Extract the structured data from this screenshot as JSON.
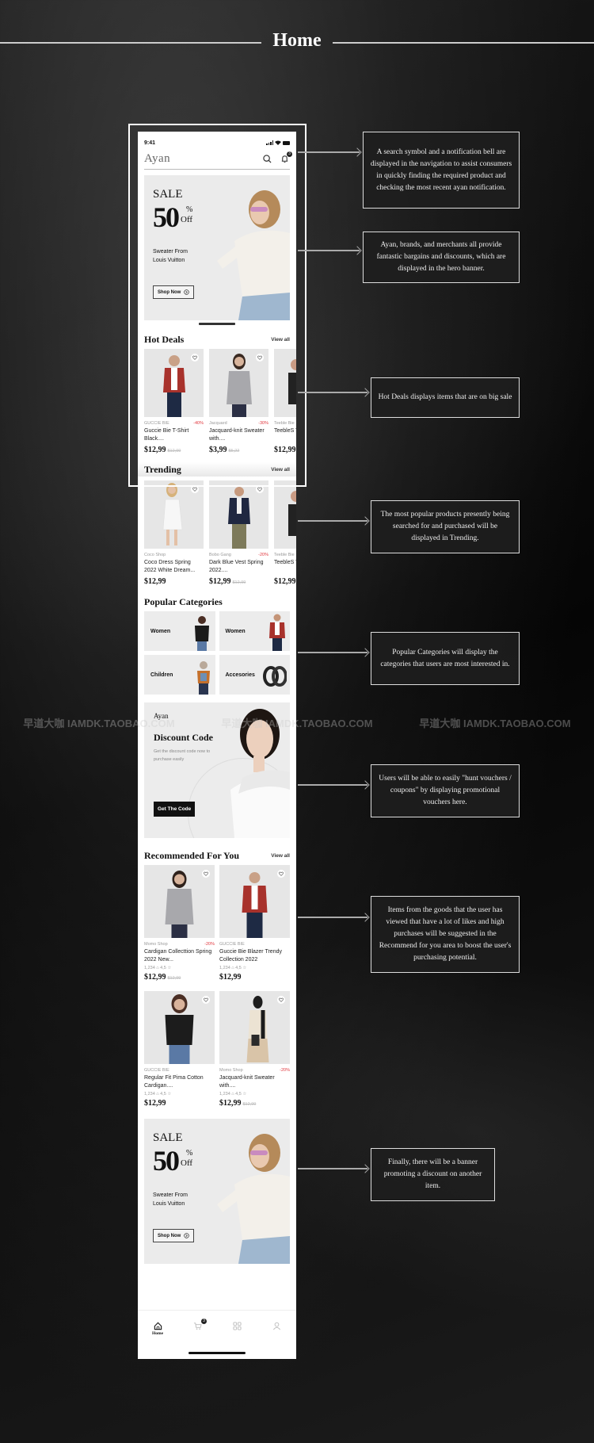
{
  "page": {
    "title": "Home"
  },
  "status_bar": {
    "time": "9:41"
  },
  "app_bar": {
    "logo": "Ayan",
    "icons": [
      "search-icon",
      "bell-icon"
    ],
    "notification_count": "3"
  },
  "hero": {
    "sale": "SALE",
    "percent": "50",
    "percent_sign": "%",
    "off": "Off",
    "subtitle": "Sweater From Louis Vuitton",
    "button": "Shop Now"
  },
  "hot_deals": {
    "title": "Hot Deals",
    "view_all": "View all",
    "items": [
      {
        "brand": "GUCCIE BIE",
        "discount": "-40%",
        "name": "Guccie Bie T-Shirt Black....",
        "price": "$12,99",
        "old_price": "$12,99"
      },
      {
        "brand": "Jacquard",
        "discount": "-30%",
        "name": "Jacquard-knit Sweater with....",
        "price": "$3,99",
        "old_price": "$5,22"
      },
      {
        "brand": "Teeble Bie",
        "discount": "",
        "name": "TeebleS Turtleneck",
        "price": "$12,99",
        "old_price": ""
      }
    ]
  },
  "trending": {
    "title": "Trending",
    "view_all": "View all",
    "items": [
      {
        "brand": "Coco Shop",
        "discount": "",
        "name": "Coco Dress Spring 2022 White Dream...",
        "price": "$12,99",
        "old_price": ""
      },
      {
        "brand": "Bobo Gang",
        "discount": "-20%",
        "name": "Dark Blue Vest Spring 2022....",
        "price": "$12,99",
        "old_price": "$12,99"
      },
      {
        "brand": "Teeble Bie",
        "discount": "",
        "name": "TeebleS Turtleneck",
        "price": "$12,99",
        "old_price": ""
      }
    ]
  },
  "popular_categories": {
    "title": "Popular Categories",
    "items": [
      "Women",
      "Women",
      "Children",
      "Accesories"
    ]
  },
  "discount_banner": {
    "brand": "Ayan",
    "title": "Discount Code",
    "subtitle": "Get the discount code now to purchase easily",
    "button": "Get The Code"
  },
  "recommended": {
    "title": "Recommended For You",
    "view_all": "View all",
    "items": [
      {
        "brand": "Momo Shop",
        "discount": "-20%",
        "name": "Cardigan Collecttion Spring 2022 New...",
        "likes": "1,234",
        "rating": "4,5",
        "price": "$12,99",
        "old_price": "$12,99"
      },
      {
        "brand": "GUCCIE BIE",
        "discount": "",
        "name": "Guccie Bie Blazer Trendy Collection 2022",
        "likes": "1,234",
        "rating": "4,5",
        "price": "$12,99",
        "old_price": ""
      },
      {
        "brand": "GUCCIE BIE",
        "discount": "",
        "name": "Regular Fit Pima Cotton Cardigan....",
        "likes": "1,234",
        "rating": "4,5",
        "price": "$12,99",
        "old_price": ""
      },
      {
        "brand": "Momo Shop",
        "discount": "-20%",
        "name": "Jacquard-knit Sweater with....",
        "likes": "1,234",
        "rating": "4,5",
        "price": "$12,99",
        "old_price": "$12,99"
      }
    ]
  },
  "bottom_banner": {
    "sale": "SALE",
    "percent": "50",
    "percent_sign": "%",
    "off": "Off",
    "subtitle": "Sweater From Louis Vuitton",
    "button": "Shop Now"
  },
  "tab_bar": {
    "tabs": [
      {
        "icon": "home-icon",
        "label": "Home"
      },
      {
        "icon": "cart-icon",
        "label": "",
        "badge": "3"
      },
      {
        "icon": "grid-icon",
        "label": ""
      },
      {
        "icon": "profile-icon",
        "label": ""
      }
    ]
  },
  "annotations": [
    "A search symbol and a notification bell are displayed in the navigation to assist consumers in quickly finding the required product and checking the most recent ayan notification.",
    "Ayan, brands, and merchants all provide fantastic bargains and discounts, which are displayed in the hero banner.",
    "Hot Deals displays items that are on big sale",
    "The most popular products presently being searched for and purchased will be displayed in Trending.",
    "Popular Categories will display the categories that users are most interested in.",
    "Users will be able to easily \"hunt vouchers / coupons\" by displaying promotional vouchers here.",
    "Items from the goods that the user has viewed that have a lot of likes and high purchases will be suggested in the Recommend for you area to boost the user's purchasing potential.",
    "Finally, there will be a banner promoting a discount on another item."
  ],
  "watermark": [
    "早道大咖 IAMDK.TAOBAO.COM",
    "早道大咖 IAMDK.TAOBAO.COM",
    "早道大咖 IAMDK.TAOBAO.COM"
  ]
}
